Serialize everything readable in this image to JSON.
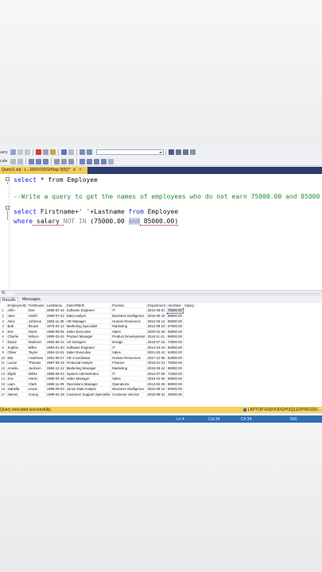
{
  "toolbar1": {
    "label": "uery"
  },
  "toolbar2": {
    "label": "cute"
  },
  "tab": {
    "title": "Query1.sql - L...EN3VODGH\\tap (83))*",
    "pin": "⊕",
    "close": "✕"
  },
  "editor": {
    "line1_kw": "select",
    "line1_rest": " * from Employee",
    "line2_comment": "--Write a query to get the names of employees who do not earn 75000.00 and 85000",
    "line3_select": "select",
    "line3_first": " Firstname+",
    "line3_str": "' '",
    "line3_plus": "+Lastname ",
    "line3_from": "from",
    "line3_table": " Employee",
    "line4_where": "where",
    "line4_salary": " salary ",
    "line4_notin": "NOT IN",
    "line4_open": " (75000.00 ",
    "line4_and": "and",
    "line4_close": " 85000.00)"
  },
  "zoom": {
    "value": "% "
  },
  "results_tabs": {
    "results": "Results",
    "messages": "Messages"
  },
  "grid": {
    "columns": [
      "EmployeeID",
      "FirstName",
      "LastName",
      "DateOfBirth",
      "Position",
      "Department",
      "HireDate",
      "Salary"
    ],
    "rows": [
      [
        "1",
        "John",
        "Doe",
        "1985-02-15",
        "Software Engineer",
        "IT",
        "2010-06-01",
        "75000.00"
      ],
      [
        "2",
        "Jane",
        "Smith",
        "1990-07-22",
        "Data Analyst",
        "Business Intelligence",
        "2015-09-10",
        "68000.00"
      ],
      [
        "3",
        "Alice",
        "Johnson",
        "1983-11-30",
        "HR Manager",
        "Human Resources",
        "2010-03-14",
        "85000.00"
      ],
      [
        "4",
        "Bob",
        "Brown",
        "1975-04-12",
        "Marketing Specialist",
        "Marketing",
        "2012-08-20",
        "67000.00"
      ],
      [
        "5",
        "Eve",
        "Davis",
        "1995-09-05",
        "Sales Executive",
        "Sales",
        "2020-01-25",
        "60000.00"
      ],
      [
        "6",
        "Charlie",
        "Wilson",
        "1980-03-24",
        "Product Manager",
        "Product Development",
        "2016-11-21",
        "95000.00"
      ],
      [
        "7",
        "David",
        "Martinez",
        "1992-08-14",
        "UX Designer",
        "Design",
        "2019-07-22",
        "70000.00"
      ],
      [
        "8",
        "Sophia",
        "Miller",
        "1983-01-30",
        "Software Engineer",
        "IT",
        "2014-04-10",
        "82000.00"
      ],
      [
        "9",
        "Oliver",
        "Taylor",
        "1994-10-02",
        "Sales Executive",
        "Sales",
        "2021-02-10",
        "62000.00"
      ],
      [
        "10",
        "Mia",
        "Anderson",
        "1981-08-27",
        "HR Coordinator",
        "Human Resources",
        "2017-12-05",
        "54000.00"
      ],
      [
        "11",
        "Lucas",
        "Thomas",
        "1987-05-19",
        "Financial Analyst",
        "Finance",
        "2015-01-21",
        "75000.00"
      ],
      [
        "12",
        "Amelia",
        "Jackson",
        "1983-12-12",
        "Marketing Manager",
        "Marketing",
        "2019-09-14",
        "88000.00"
      ],
      [
        "13",
        "Elijah",
        "White",
        "1989-09-23",
        "System Administrator",
        "IT",
        "2012-07-09",
        "71000.00"
      ],
      [
        "14",
        "Zoe",
        "Harris",
        "1990-04-18",
        "Sales Manager",
        "Sales",
        "2016-10-30",
        "95000.00"
      ],
      [
        "15",
        "Liam",
        "Clark",
        "1985-11-09",
        "Operations Manager",
        "Operations",
        "2013-02-25",
        "88000.00"
      ],
      [
        "16",
        "Isabella",
        "Lewis",
        "1996-05-03",
        "Junior Data Analyst",
        "Business Intelligence",
        "2022-09-12",
        "50000.00"
      ],
      [
        "17",
        "James",
        "Young",
        "1989-02-18",
        "Customer Support Specialist",
        "Customer Service",
        "2018-08-31",
        "48000.00"
      ]
    ]
  },
  "status": {
    "message": "Query executed successfully.",
    "server": "LAPTOP-EN3VODGH\\SQLEXPRESS0..."
  },
  "bottom_status": {
    "ln": "Ln 4",
    "col": "Col 34",
    "ch": "Ch 34",
    "mode": "INS"
  },
  "colors": {
    "tab_active": "#f5cc52",
    "status_bar": "#f5d25e",
    "bottom_bar": "#2f6fb5",
    "keyword": "#1f26d8",
    "comment": "#1e8c3a",
    "string": "#b5121b"
  }
}
